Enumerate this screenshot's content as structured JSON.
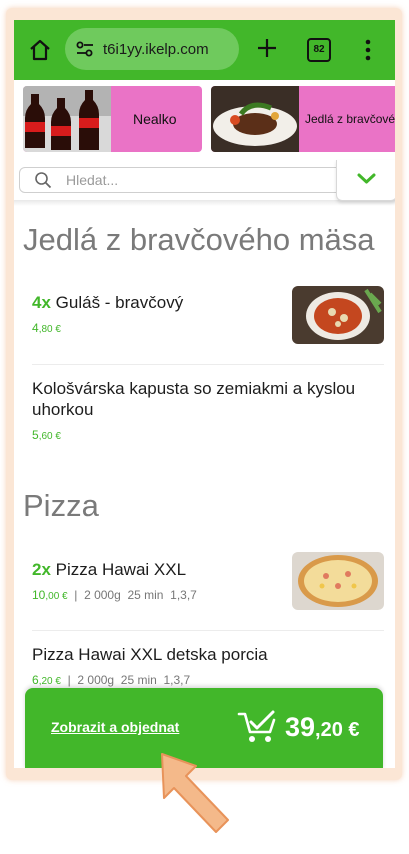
{
  "browser": {
    "url": "t6i1yy.ikelp.com",
    "tab_count": "82"
  },
  "categories": [
    {
      "label": "Nealko",
      "image": "cola-bottles"
    },
    {
      "label": "Jedlá z bravčového mäsa",
      "image": "steak-plate"
    }
  ],
  "search": {
    "placeholder": "Hledat..."
  },
  "sections": [
    {
      "title": "Jedlá z bravčového mäsa",
      "items": [
        {
          "qty": "4x",
          "name": "Guláš - bravčový",
          "price_int": "4",
          "price_dec": ",80 €",
          "image": "goulash-plate"
        },
        {
          "qty": "",
          "name": "Kološvárska kapusta so zemiakmi a kyslou uhorkou",
          "price_int": "5",
          "price_dec": ",60 €"
        }
      ]
    },
    {
      "title": "Pizza",
      "items": [
        {
          "qty": "2x",
          "name": "Pizza Hawai XXL",
          "price_int": "10",
          "price_dec": ",00 €",
          "sep": "|",
          "weight": "2 000g",
          "time": "25 min",
          "allergens": "1,3,7",
          "image": "pizza"
        },
        {
          "qty": "",
          "name": "Pizza Hawai XXL detska porcia",
          "price_int": "6",
          "price_dec": ",20 €",
          "sep": "|",
          "weight": "2 000g",
          "time": "25 min",
          "allergens": "1,3,7"
        }
      ]
    }
  ],
  "cart": {
    "action_label": "Zobrazit a objednat",
    "total_int": "39",
    "total_dec": ",20 €"
  },
  "colors": {
    "brand_green": "#42b72a",
    "category_pink": "#ea73c6",
    "cursor_orange": "#f4b98a"
  }
}
